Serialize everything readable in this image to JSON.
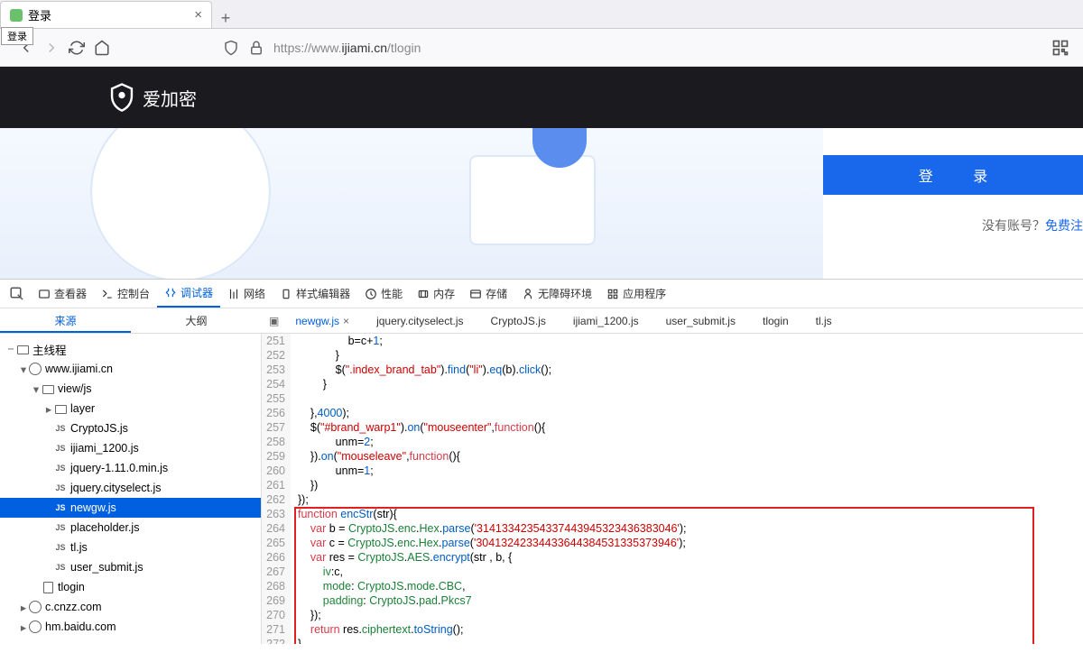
{
  "browser": {
    "tab_title": "登录",
    "tooltip": "登录",
    "url_prefix": "https://www.",
    "url_domain": "ijiami.cn",
    "url_path": "/tlogin"
  },
  "site": {
    "brand": "爱加密",
    "login_button": "登 录",
    "no_account": "没有账号？",
    "register": "免费注"
  },
  "devtools": {
    "tabs": [
      "查看器",
      "控制台",
      "调试器",
      "网络",
      "样式编辑器",
      "性能",
      "内存",
      "存储",
      "无障碍环境",
      "应用程序"
    ],
    "active_tab": 2,
    "sub_tabs": [
      "来源",
      "大纲"
    ],
    "active_sub": 0,
    "open_files": [
      "newgw.js",
      "jquery.cityselect.js",
      "CryptoJS.js",
      "ijiami_1200.js",
      "user_submit.js",
      "tlogin",
      "tl.js"
    ],
    "active_file": 0
  },
  "tree": [
    {
      "d": 0,
      "tw": "−",
      "icon": "box",
      "label": "主线程"
    },
    {
      "d": 1,
      "tw": "▾",
      "icon": "globe",
      "label": "www.ijiami.cn"
    },
    {
      "d": 2,
      "tw": "▾",
      "icon": "folder",
      "label": "view/js"
    },
    {
      "d": 3,
      "tw": "▸",
      "icon": "folder",
      "label": "layer"
    },
    {
      "d": 3,
      "tw": "",
      "icon": "js",
      "label": "CryptoJS.js"
    },
    {
      "d": 3,
      "tw": "",
      "icon": "js",
      "label": "ijiami_1200.js"
    },
    {
      "d": 3,
      "tw": "",
      "icon": "js",
      "label": "jquery-1.11.0.min.js"
    },
    {
      "d": 3,
      "tw": "",
      "icon": "js",
      "label": "jquery.cityselect.js"
    },
    {
      "d": 3,
      "tw": "",
      "icon": "js",
      "label": "newgw.js",
      "selected": true
    },
    {
      "d": 3,
      "tw": "",
      "icon": "js",
      "label": "placeholder.js"
    },
    {
      "d": 3,
      "tw": "",
      "icon": "js",
      "label": "tl.js"
    },
    {
      "d": 3,
      "tw": "",
      "icon": "js",
      "label": "user_submit.js"
    },
    {
      "d": 2,
      "tw": "",
      "icon": "doc",
      "label": "tlogin"
    },
    {
      "d": 1,
      "tw": "▸",
      "icon": "globe",
      "label": "c.cnzz.com"
    },
    {
      "d": 1,
      "tw": "▸",
      "icon": "globe",
      "label": "hm.baidu.com"
    }
  ],
  "code": {
    "start": 251,
    "lines": [
      "                b=c+1;",
      "            }",
      "            $(\".index_brand_tab\").find(\"li\").eq(b).click();",
      "        }",
      "",
      "    },4000);",
      "    $(\"#brand_warp1\").on(\"mouseenter\",function(){",
      "            unm=2;",
      "    }).on(\"mouseleave\",function(){",
      "            unm=1;",
      "    })",
      "});",
      "function encStr(str){",
      "    var b = CryptoJS.enc.Hex.parse('31413342354337443945323436383046');",
      "    var c = CryptoJS.enc.Hex.parse('30413242334433644384531335373946');",
      "    var res = CryptoJS.AES.encrypt(str , b, {",
      "        iv:c,",
      "        mode: CryptoJS.mode.CBC,",
      "        padding: CryptoJS.pad.Pkcs7",
      "    });",
      "    return res.ciphertext.toString();",
      "}"
    ]
  }
}
